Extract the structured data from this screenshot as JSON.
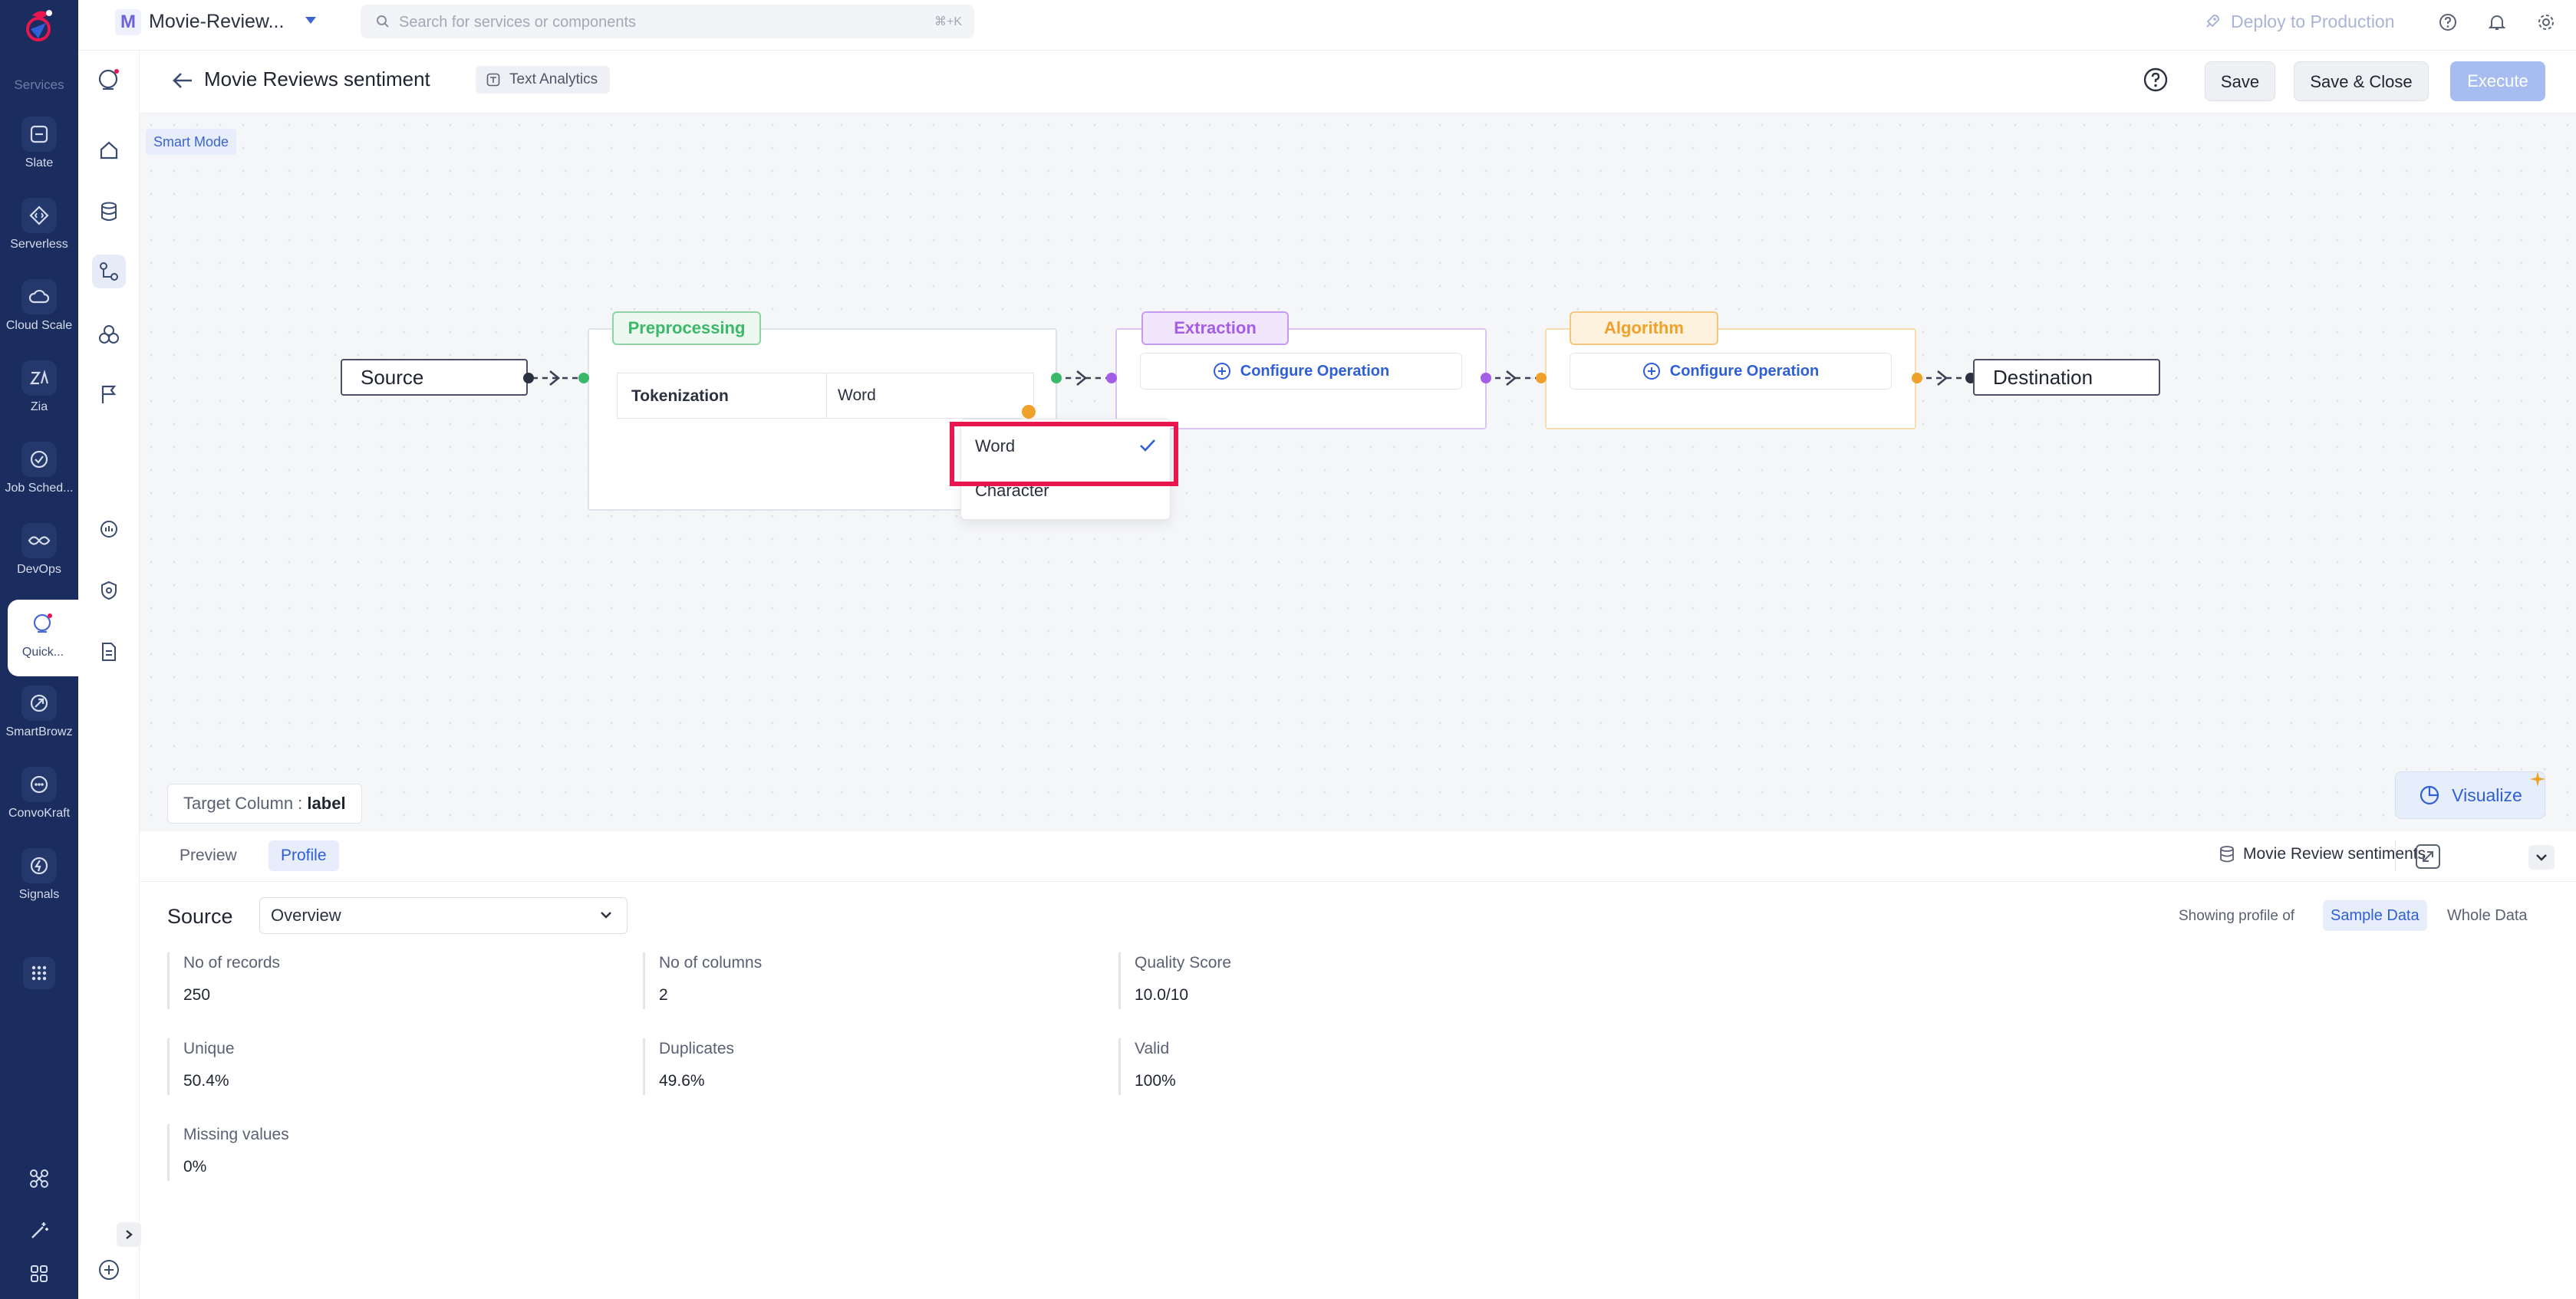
{
  "rail": {
    "heading": "Services",
    "items": [
      {
        "label": "Slate",
        "icon": "slate-icon"
      },
      {
        "label": "Serverless",
        "icon": "serverless-icon"
      },
      {
        "label": "Cloud Scale",
        "icon": "cloud-scale-icon"
      },
      {
        "label": "Zia",
        "icon": "zia-icon"
      },
      {
        "label": "Job Sched...",
        "icon": "job-scheduling-icon"
      },
      {
        "label": "DevOps",
        "icon": "devops-icon"
      },
      {
        "label": "Quick...",
        "icon": "quickml-icon"
      },
      {
        "label": "SmartBrowz",
        "icon": "smartbrowz-icon"
      },
      {
        "label": "ConvoKraft",
        "icon": "convokraft-icon"
      },
      {
        "label": "Signals",
        "icon": "signals-icon"
      }
    ]
  },
  "topbar": {
    "project_initial": "M",
    "project_name": "Movie-Review...",
    "search_placeholder": "Search for services or components",
    "search_shortcut": "⌘+K",
    "deploy_label": "Deploy to Production"
  },
  "header": {
    "title": "Movie Reviews sentiment",
    "chip": "Text Analytics",
    "save": "Save",
    "save_close": "Save & Close",
    "execute": "Execute"
  },
  "canvas": {
    "smart_mode": "Smart Mode",
    "source": "Source",
    "destination": "Destination",
    "preprocessing": {
      "title": "Preprocessing",
      "row_label": "Tokenization",
      "row_value": "Word"
    },
    "extraction": {
      "title": "Extraction",
      "configure": "Configure Operation"
    },
    "algorithm": {
      "title": "Algorithm",
      "configure": "Configure Operation"
    },
    "dropdown_options": [
      "Word",
      "Character"
    ],
    "target_column_label": "Target Column :",
    "target_column_value": "label",
    "visualize": "Visualize"
  },
  "panel": {
    "tabs": [
      "Preview",
      "Profile"
    ],
    "dataset": "Movie Review sentiments",
    "section_title": "Source",
    "select_value": "Overview",
    "showing_profile_of": "Showing profile of",
    "profile_options": [
      "Sample Data",
      "Whole Data"
    ],
    "stats": [
      {
        "key": "No of records",
        "value": "250"
      },
      {
        "key": "No of columns",
        "value": "2"
      },
      {
        "key": "Quality Score",
        "value": "10.0/10"
      },
      {
        "key": "Unique",
        "value": "50.4%"
      },
      {
        "key": "Duplicates",
        "value": "49.6%"
      },
      {
        "key": "Valid",
        "value": "100%"
      },
      {
        "key": "Missing values",
        "value": "0%"
      }
    ]
  },
  "colors": {
    "rail_bg": "#1a2d5e",
    "accent": "#2f5fd6",
    "preprocessing": "#3bb86a",
    "extraction": "#a45ee6",
    "algorithm": "#f0a12a",
    "highlight": "#e8154f"
  }
}
